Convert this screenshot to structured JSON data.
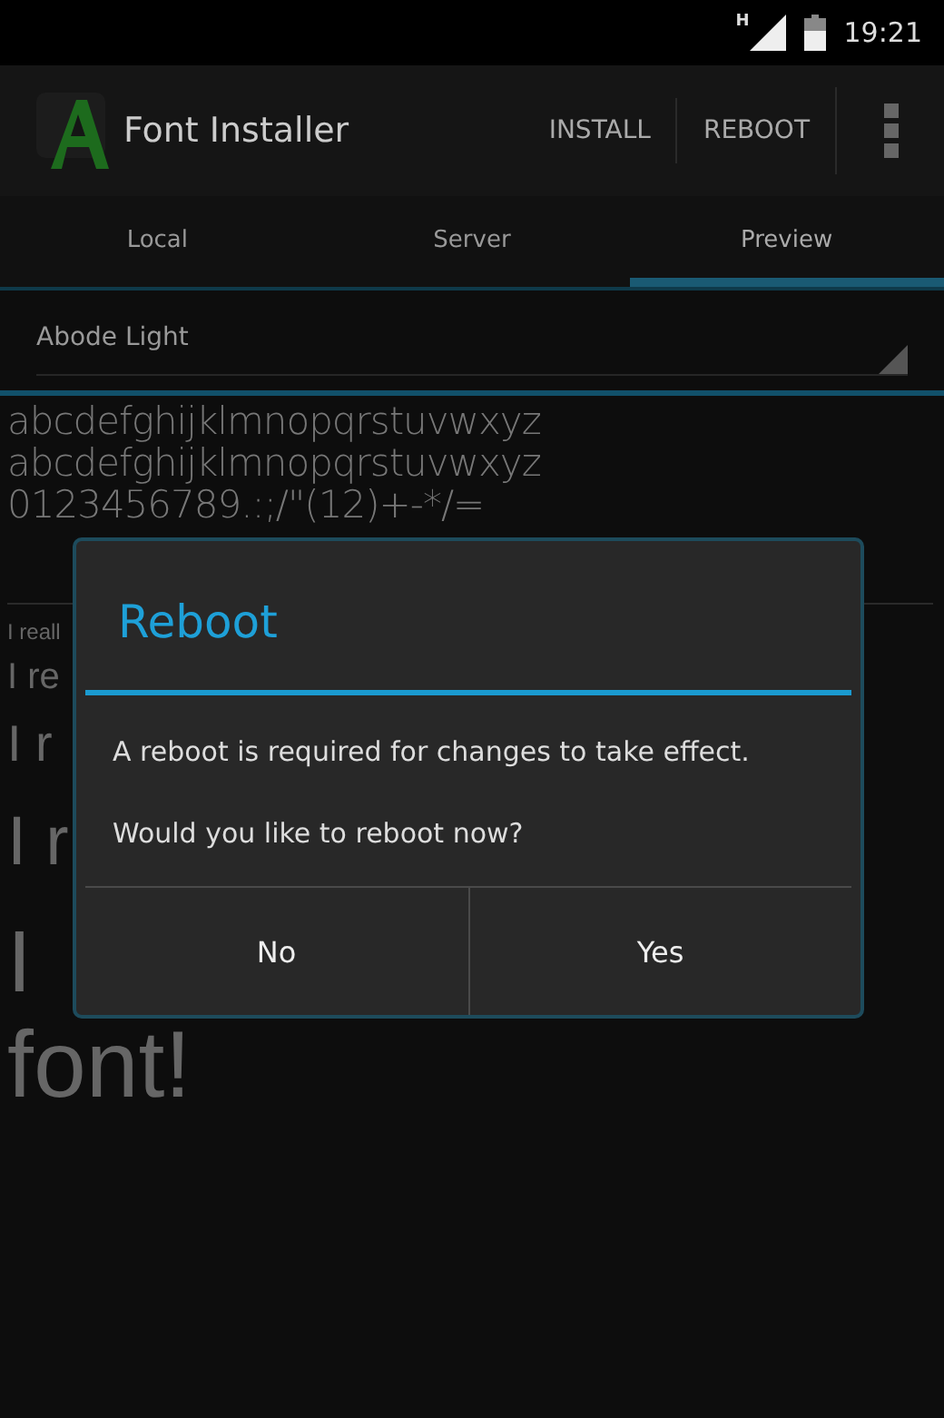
{
  "status_bar": {
    "network": "H",
    "time": "19:21"
  },
  "action_bar": {
    "title": "Font Installer",
    "actions": [
      "INSTALL",
      "REBOOT"
    ]
  },
  "tabs": [
    {
      "label": "Local",
      "selected": false
    },
    {
      "label": "Server",
      "selected": false
    },
    {
      "label": "Preview",
      "selected": true
    }
  ],
  "font_spinner": {
    "value": "Abode Light"
  },
  "preview": {
    "charset": [
      "abcdefghijklmnopqrstuvwxyz",
      "abcdefghijklmnopqrstuvwxyz",
      "0123456789.:;/\"(12)+-*/="
    ],
    "samples": [
      "I reall",
      "I re",
      "I r",
      "I r",
      "I",
      "font!"
    ]
  },
  "dialog": {
    "title": "Reboot",
    "messages": [
      "A reboot is required for changes to take effect.",
      "Would you like to reboot now?"
    ],
    "buttons": [
      "No",
      "Yes"
    ]
  }
}
